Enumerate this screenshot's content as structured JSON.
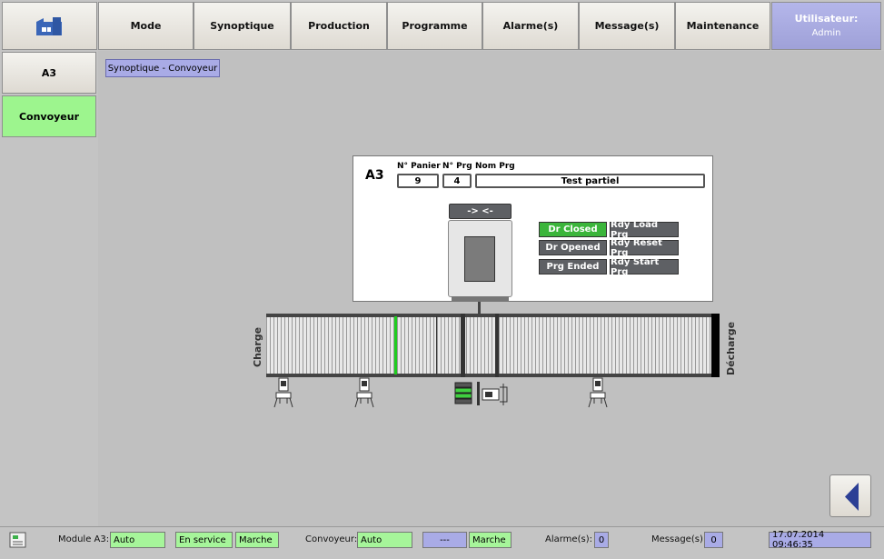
{
  "nav": {
    "home_icon": "factory-icon",
    "items": [
      "Mode",
      "Synoptique",
      "Production",
      "Programme",
      "Alarme(s)",
      "Message(s)",
      "Maintenance"
    ],
    "user_title": "Utilisateur:",
    "user_name": "Admin"
  },
  "sidebar": {
    "items": [
      "A3",
      "Convoyeur"
    ],
    "active": "Convoyeur"
  },
  "breadcrumb": "Synoptique - Convoyeur",
  "panel": {
    "station": "A3",
    "panier_label": "N° Panier",
    "prg_label": "N° Prg",
    "nom_label": "Nom Prg",
    "panier_value": "9",
    "prg_value": "4",
    "nom_value": "Test partiel",
    "door_button": "-> <-",
    "status_buttons": [
      {
        "label": "Dr Closed",
        "color": "#3bb53b"
      },
      {
        "label": "Rdy Load Prg",
        "color": "#5e6064"
      },
      {
        "label": "Dr Opened",
        "color": "#5e6064"
      },
      {
        "label": "Rdy Reset Prg",
        "color": "#5e6064"
      },
      {
        "label": "Prg Ended",
        "color": "#5e6064"
      },
      {
        "label": "Rdy Start Prg",
        "color": "#5e6064"
      }
    ]
  },
  "conveyor": {
    "left_label": "Charge",
    "right_label": "Décharge"
  },
  "status": {
    "module_label": "Module A3:",
    "module_mode": "Auto",
    "module_state": "En service",
    "module_run": "Marche",
    "conv_label": "Convoyeur:",
    "conv_mode": "Auto",
    "conv_blank": "---",
    "conv_run": "Marche",
    "alarm_label": "Alarme(s):",
    "alarm_count": "0",
    "msg_label": "Message(s):",
    "msg_count": "0",
    "datetime": "17.07.2014 09:46:35"
  },
  "colors": {
    "active_green": "#9df58e",
    "status_green": "#a6f59a",
    "accent_purple": "#a9abe6"
  }
}
